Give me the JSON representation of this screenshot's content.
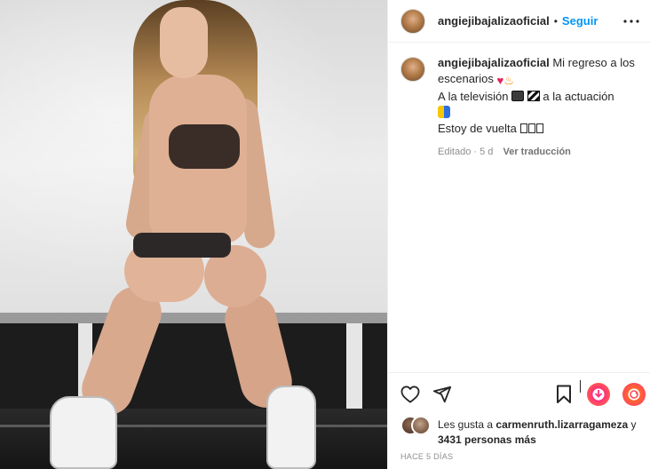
{
  "post": {
    "username": "angiejibajalizaoficial",
    "follow_label": "Seguir",
    "more_icon": "more-options-icon",
    "caption": {
      "line1_text": "Mi regreso a los escenarios",
      "line1_emojis": [
        "red-heart",
        "fire"
      ],
      "line2_text_before": "A la televisión",
      "line2_emojis": [
        "television",
        "clapper-board"
      ],
      "line2_text_after": "a la actuación",
      "line3_emoji": "performing-arts",
      "line4_text": "Estoy de vuelta",
      "line4_trailing_glyphs": 3,
      "edited_label": "Editado",
      "age": "5 d",
      "translate_label": "Ver traducción"
    },
    "actions": {
      "like_icon": "heart-outline-icon",
      "share_icon": "send-icon",
      "save_icon": "bookmark-icon"
    },
    "likes": {
      "prefix": "Les gusta a",
      "user": "carmenruth.lizarragameza",
      "conjunction": "y",
      "others": "3431 personas más"
    },
    "timestamp": "Hace 5 días"
  },
  "colors": {
    "link_blue": "#0095f6",
    "text_primary": "#262626",
    "text_secondary": "#8e8e8e"
  }
}
